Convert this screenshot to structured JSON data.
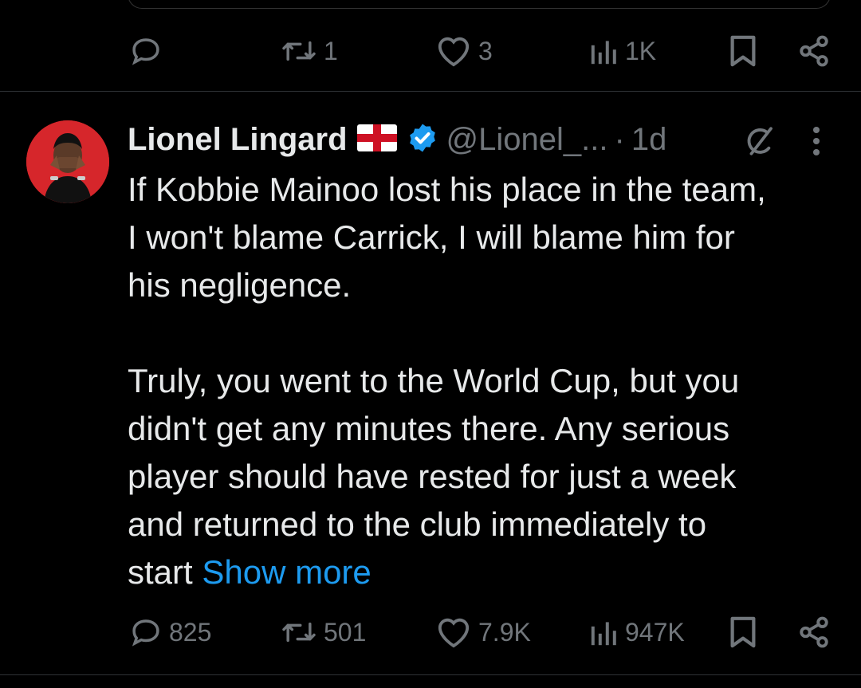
{
  "prev_tweet": {
    "actions": {
      "reply_count": "",
      "retweet_count": "1",
      "like_count": "3",
      "view_count": "1K"
    }
  },
  "tweet": {
    "author_name": "Lionel Lingard",
    "author_flag": "england-flag",
    "handle": "@Lionel_...",
    "separator": "·",
    "time": "1d",
    "text_line1": "If Kobbie Mainoo lost his place in the team,",
    "text_line2": "I won't blame Carrick, I will blame him for",
    "text_line3": "his negligence.",
    "text_line4": "Truly, you went to the World Cup, but you",
    "text_line5": "didn't get any minutes there. Any serious",
    "text_line6": "player should have rested for just a week",
    "text_line7": "and returned to the club immediately to",
    "text_line8": "start",
    "show_more": "Show more",
    "actions": {
      "reply_count": "825",
      "retweet_count": "501",
      "like_count": "7.9K",
      "view_count": "947K"
    }
  },
  "colors": {
    "background": "#000000",
    "text": "#e7e9ea",
    "muted": "#71767b",
    "link": "#1d9bf0",
    "verified": "#1d9bf0",
    "divider": "#2f3336"
  }
}
